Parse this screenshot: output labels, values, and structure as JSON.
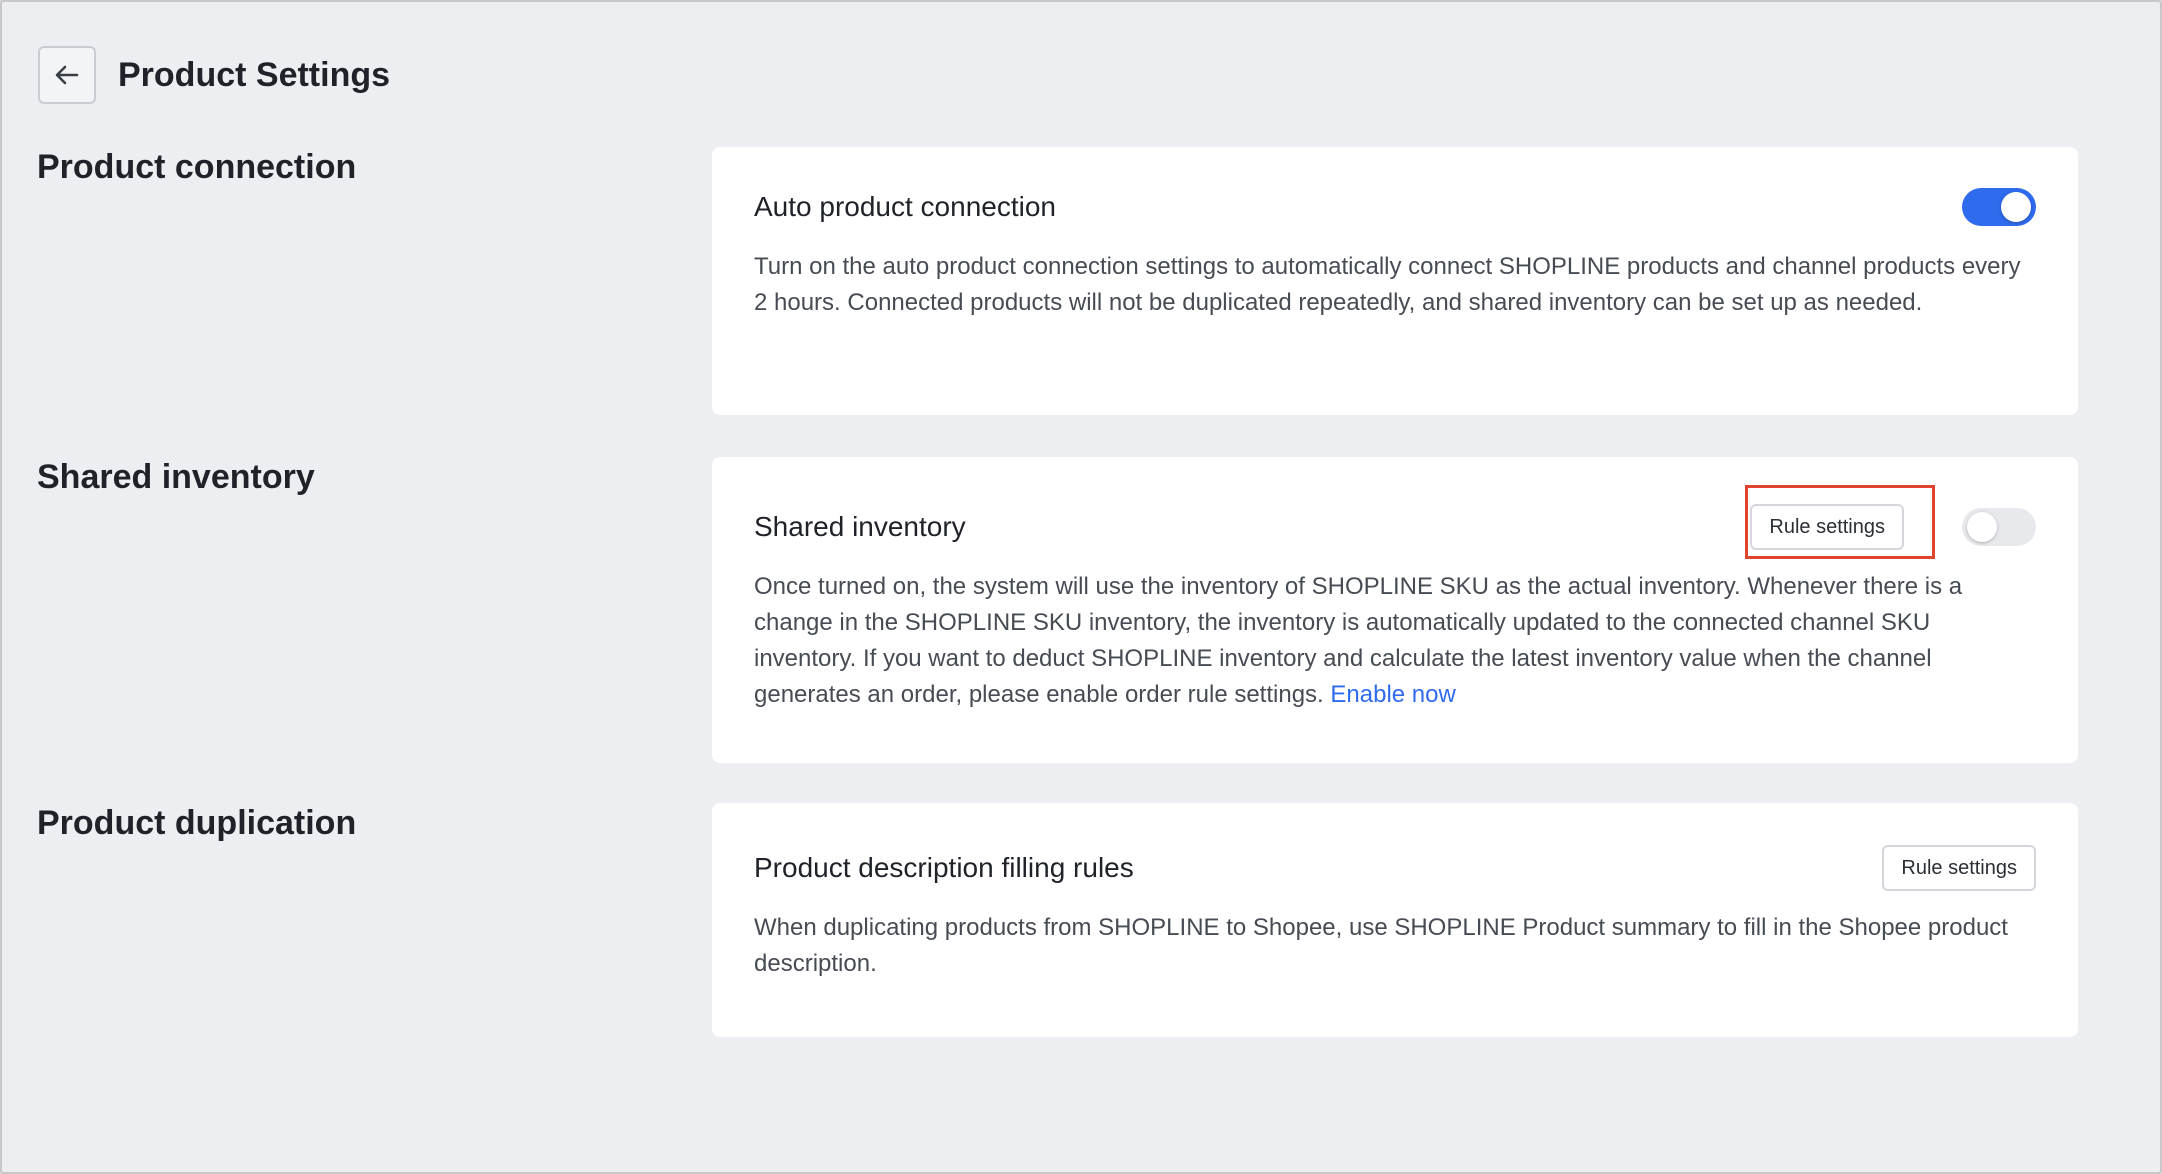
{
  "header": {
    "title": "Product Settings"
  },
  "sections": {
    "product_connection": {
      "title": "Product connection",
      "card_title": "Auto product connection",
      "toggle_on": true,
      "description": "Turn on the auto product connection settings to automatically connect SHOPLINE products and channel products every 2 hours. Connected products will not be duplicated repeatedly, and shared inventory can be set up as needed."
    },
    "shared_inventory": {
      "title": "Shared inventory",
      "card_title": "Shared inventory",
      "rule_button": "Rule settings",
      "toggle_on": false,
      "description": "Once turned on, the system will use the inventory of SHOPLINE SKU as the actual inventory. Whenever there is a change in the SHOPLINE SKU inventory, the inventory is automatically updated to the connected channel SKU inventory. If you want to deduct SHOPLINE inventory and calculate the latest inventory value when the channel generates an order, please enable order rule settings.",
      "link": "Enable now"
    },
    "product_duplication": {
      "title": "Product duplication",
      "card_title": "Product description filling rules",
      "rule_button": "Rule settings",
      "description": "When duplicating products from SHOPLINE to Shopee, use SHOPLINE Product summary to fill in the Shopee product description."
    }
  },
  "colors": {
    "accent": "#2f6bed",
    "highlight": "#e0432e",
    "background": "#edeef2",
    "card": "#ffffff"
  },
  "icons": {
    "back": "arrow-left-icon"
  }
}
